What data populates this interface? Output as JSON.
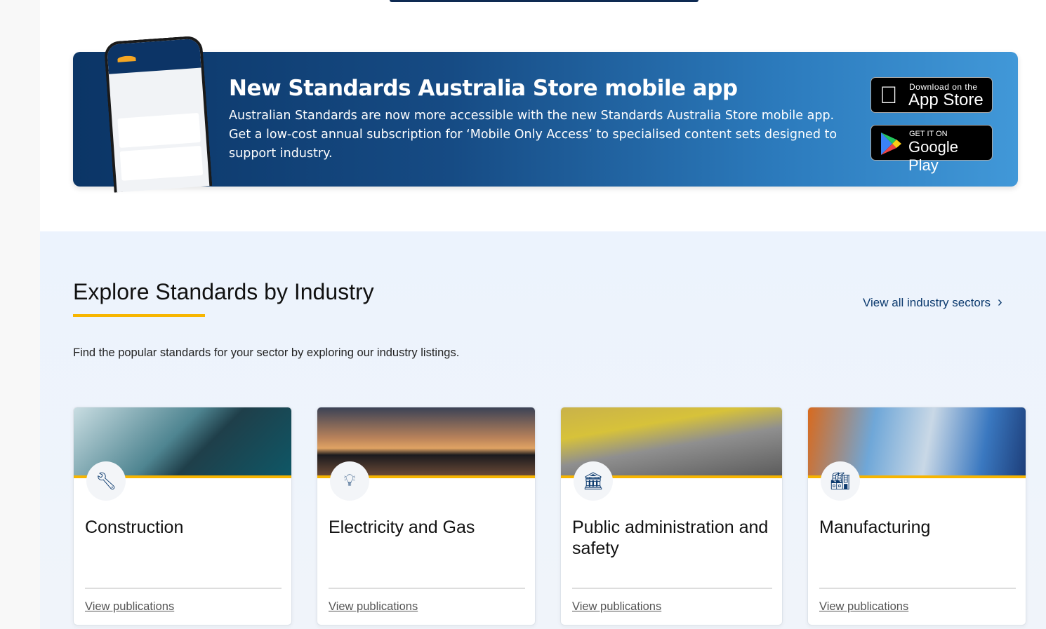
{
  "banner": {
    "title": "New Standards Australia Store mobile app",
    "description": "Australian Standards are now more accessible with the new Standards Australia Store mobile app. Get a low-cost annual subscription for ‘Mobile Only Access’ to specialised content sets designed to support industry.",
    "app_store": {
      "line1": "Download on the",
      "line2": "App Store",
      "icon": "apple-icon"
    },
    "google_play": {
      "line1": "GET IT ON",
      "line2": "Google Play",
      "icon": "google-play-icon"
    }
  },
  "industry": {
    "heading": "Explore Standards by Industry",
    "view_all": "View all industry sectors",
    "intro": "Find the popular standards for your sector by exploring our industry listings.",
    "accent": "#f7b500",
    "cards": [
      {
        "title": "Construction",
        "icon": "wrench-icon",
        "link": "View publications"
      },
      {
        "title": "Electricity and Gas",
        "icon": "lightbulb-icon",
        "link": "View publications"
      },
      {
        "title": "Public administration and safety",
        "icon": "government-building-icon",
        "link": "View publications"
      },
      {
        "title": "Manufacturing",
        "icon": "factory-icon",
        "link": "View publications"
      }
    ]
  }
}
